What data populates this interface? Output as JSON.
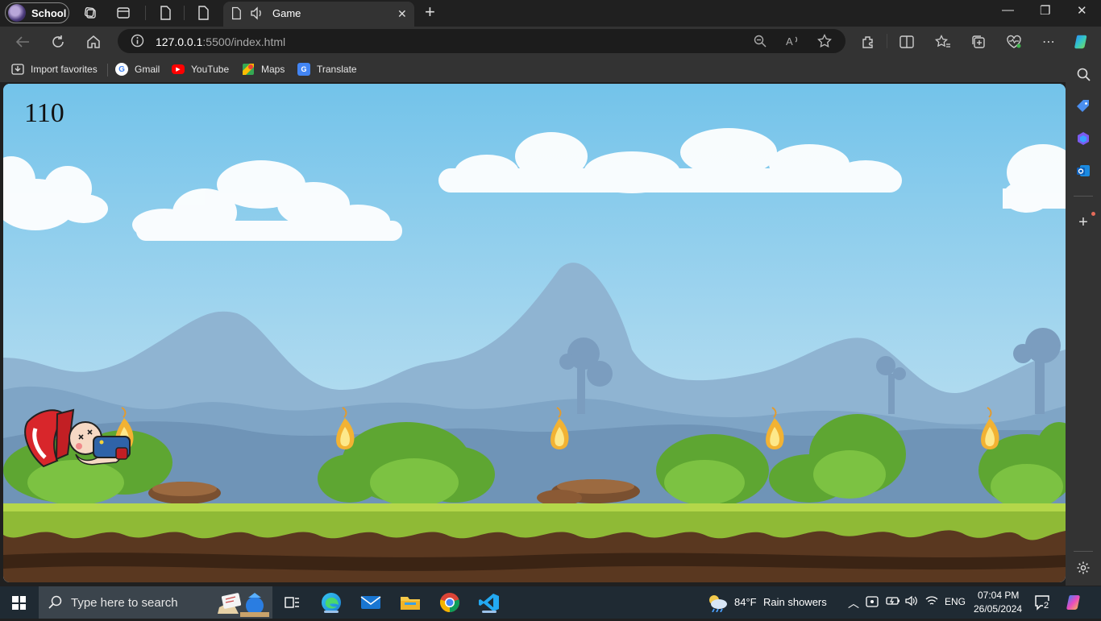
{
  "browser": {
    "profile_name": "School",
    "active_tab_title": "Game",
    "tab_close": "✕",
    "new_tab": "+",
    "url_host": "127.0.0.1",
    "url_path": ":5500/index.html",
    "window_controls": {
      "minimize": "—",
      "restore": "❐",
      "close": "✕"
    }
  },
  "favorites": [
    {
      "label": "Import favorites",
      "icon": "import-icon"
    },
    {
      "label": "Gmail",
      "icon": "google-icon"
    },
    {
      "label": "YouTube",
      "icon": "youtube-icon"
    },
    {
      "label": "Maps",
      "icon": "maps-icon"
    },
    {
      "label": "Translate",
      "icon": "translate-icon"
    }
  ],
  "game": {
    "score": "110"
  },
  "taskbar": {
    "search_placeholder": "Type here to search",
    "weather_temp": "84°F",
    "weather_desc": "Rain showers",
    "language": "ENG",
    "time": "07:04 PM",
    "date": "26/05/2024",
    "notification_count": "2"
  }
}
